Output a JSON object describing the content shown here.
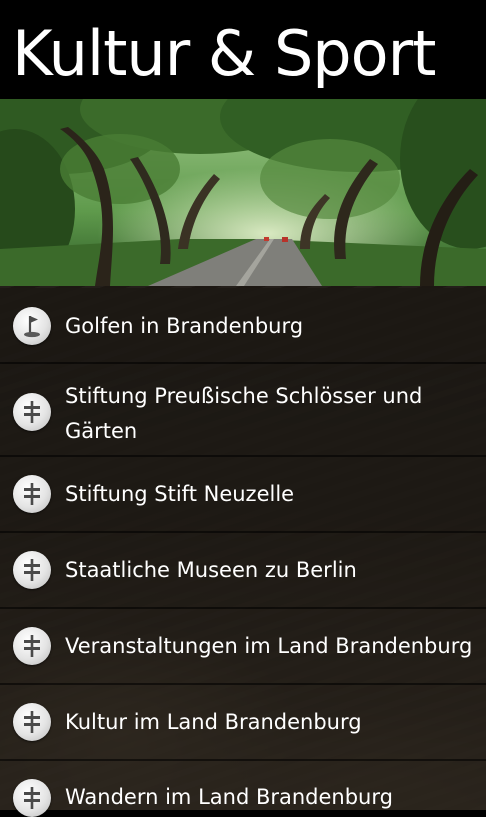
{
  "header": {
    "title": "Kultur & Sport"
  },
  "hero_image": {
    "subject": "forest road under tree canopy"
  },
  "list": {
    "items": [
      {
        "label": "Golfen in Brandenburg",
        "icon": "golf-icon"
      },
      {
        "label": "Stiftung Preußische Schlösser und Gärten",
        "icon": "signpost-icon"
      },
      {
        "label": "Stiftung Stift Neuzelle",
        "icon": "signpost-icon"
      },
      {
        "label": "Staatliche Museen zu Berlin",
        "icon": "signpost-icon"
      },
      {
        "label": "Veranstaltungen im Land Brandenburg",
        "icon": "signpost-icon"
      },
      {
        "label": "Kultur im Land Brandenburg",
        "icon": "signpost-icon"
      },
      {
        "label": "Wandern im Land Brandenburg",
        "icon": "signpost-icon"
      }
    ]
  },
  "colors": {
    "background": "#000000",
    "list_item_background": "#1c1814",
    "text": "#ffffff",
    "icon_circle": "#e4e4e4",
    "icon_glyph": "#4a4a4a"
  }
}
